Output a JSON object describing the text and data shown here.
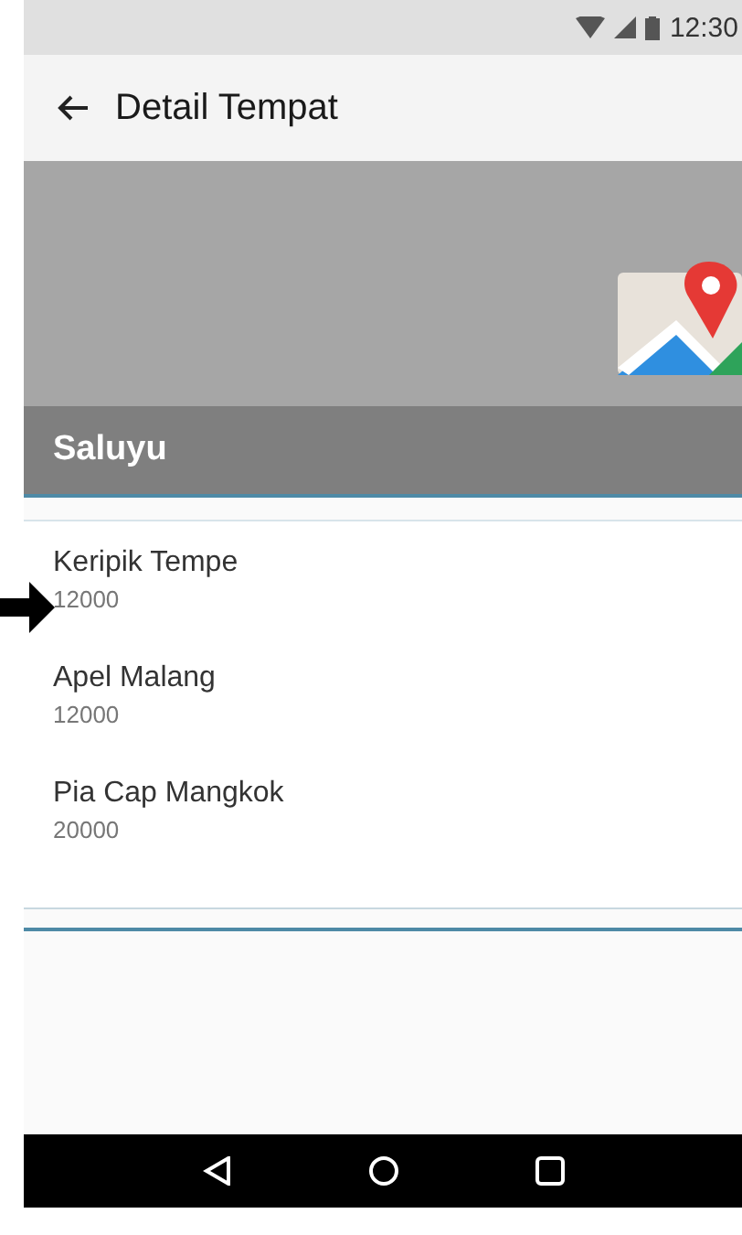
{
  "status_bar": {
    "time": "12:30"
  },
  "app_bar": {
    "title": "Detail Tempat"
  },
  "section": {
    "title": "Saluyu"
  },
  "items": [
    {
      "name": "Keripik Tempe",
      "price": "12000",
      "pointed": true
    },
    {
      "name": "Apel Malang",
      "price": "12000",
      "pointed": false
    },
    {
      "name": "Pia Cap Mangkok",
      "price": "20000",
      "pointed": false
    }
  ]
}
